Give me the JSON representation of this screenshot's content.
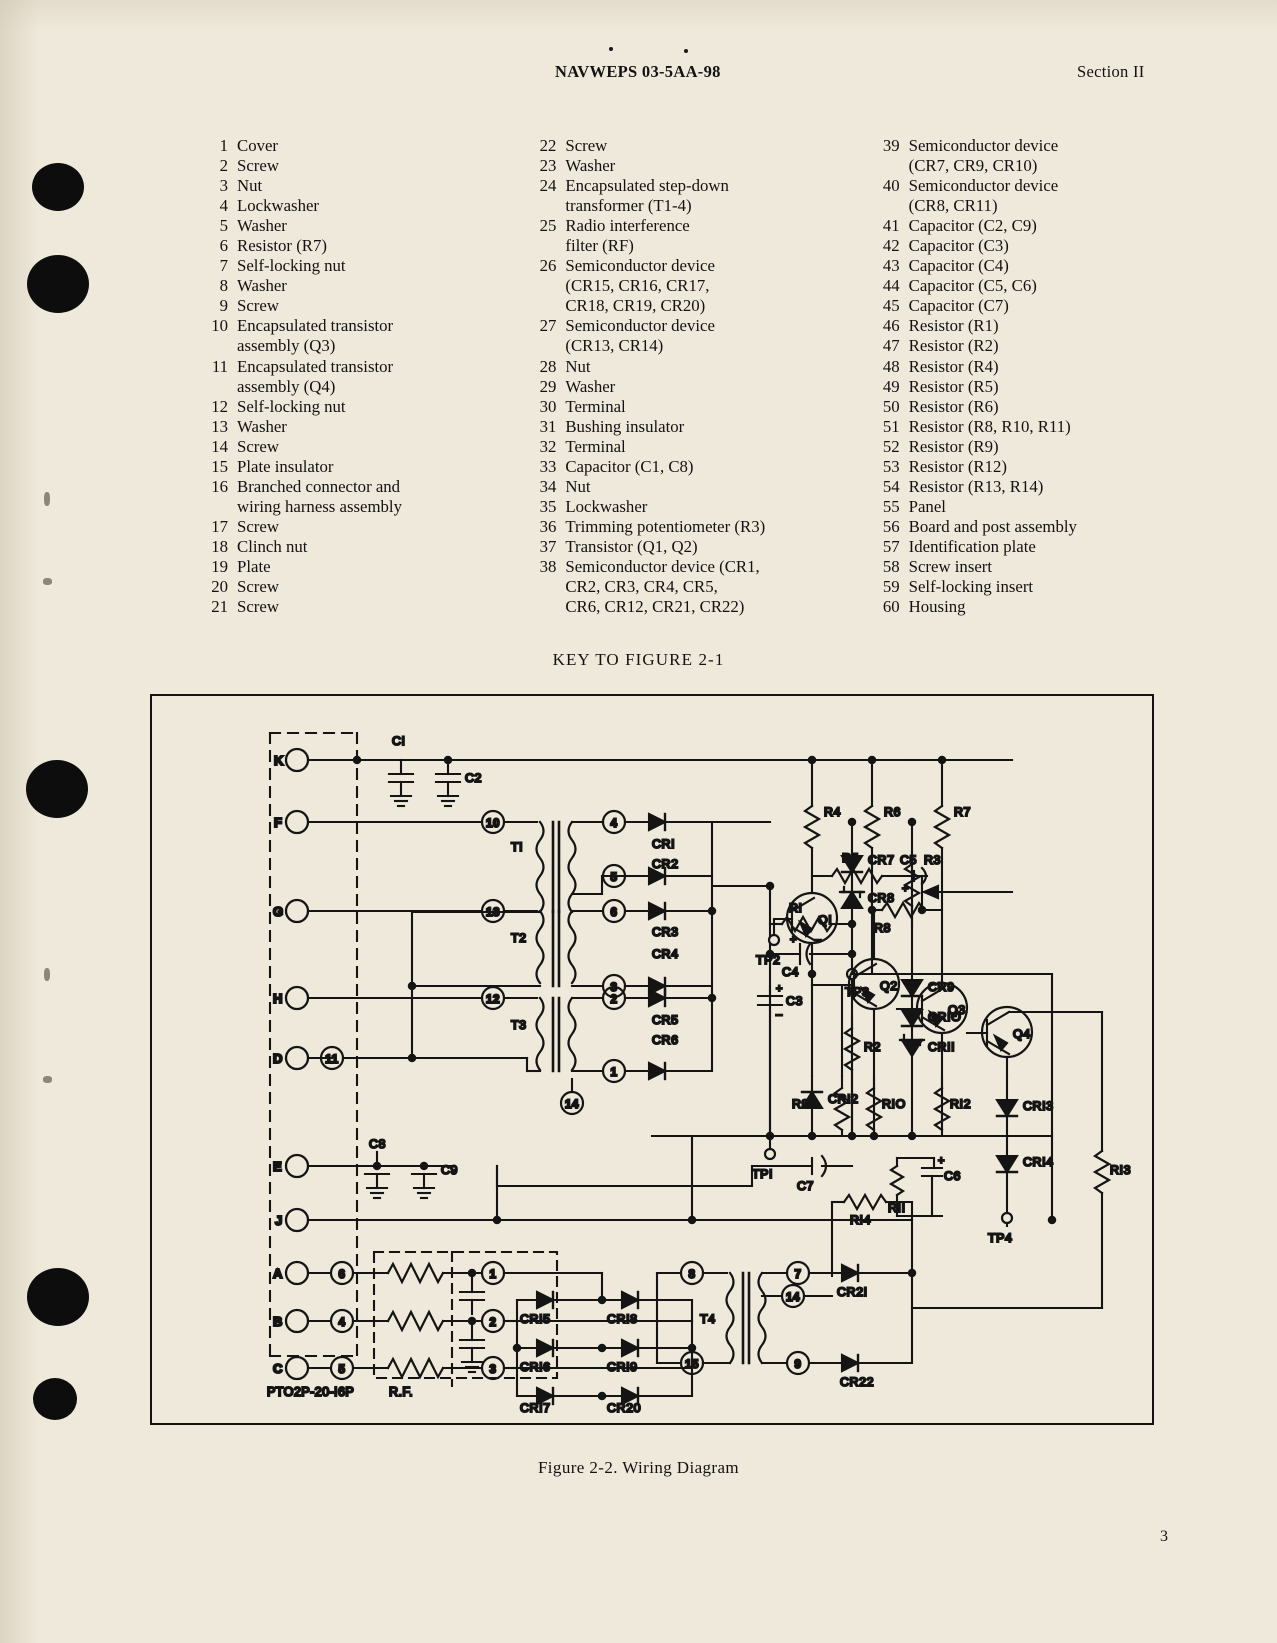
{
  "header": {
    "doc_number": "NAVWEPS 03-5AA-98",
    "section": "Section II"
  },
  "key_caption": "KEY TO FIGURE 2-1",
  "figure_caption": "Figure 2-2.  Wiring Diagram",
  "page_number": "3",
  "parts_key": {
    "column1": [
      {
        "num": "1",
        "text": "Cover"
      },
      {
        "num": "2",
        "text": "Screw"
      },
      {
        "num": "3",
        "text": "Nut"
      },
      {
        "num": "4",
        "text": "Lockwasher"
      },
      {
        "num": "5",
        "text": "Washer"
      },
      {
        "num": "6",
        "text": "Resistor (R7)"
      },
      {
        "num": "7",
        "text": "Self-locking nut"
      },
      {
        "num": "8",
        "text": "Washer"
      },
      {
        "num": "9",
        "text": "Screw"
      },
      {
        "num": "10",
        "text": "Encapsulated transistor",
        "cont": [
          "assembly (Q3)"
        ]
      },
      {
        "num": "11",
        "text": "Encapsulated transistor",
        "cont": [
          "assembly (Q4)"
        ]
      },
      {
        "num": "12",
        "text": "Self-locking nut"
      },
      {
        "num": "13",
        "text": "Washer"
      },
      {
        "num": "14",
        "text": "Screw"
      },
      {
        "num": "15",
        "text": "Plate insulator"
      },
      {
        "num": "16",
        "text": "Branched connector and",
        "cont": [
          "wiring harness assembly"
        ]
      },
      {
        "num": "17",
        "text": "Screw"
      },
      {
        "num": "18",
        "text": "Clinch nut"
      },
      {
        "num": "19",
        "text": "Plate"
      },
      {
        "num": "20",
        "text": "Screw"
      },
      {
        "num": "21",
        "text": "Screw"
      }
    ],
    "column2": [
      {
        "num": "22",
        "text": "Screw"
      },
      {
        "num": "23",
        "text": "Washer"
      },
      {
        "num": "24",
        "text": "Encapsulated step-down",
        "cont": [
          "transformer (T1-4)"
        ]
      },
      {
        "num": "25",
        "text": "Radio interference",
        "cont": [
          "filter (RF)"
        ]
      },
      {
        "num": "26",
        "text": "Semiconductor device",
        "cont": [
          "(CR15, CR16, CR17,",
          "CR18, CR19, CR20)"
        ]
      },
      {
        "num": "27",
        "text": "Semiconductor device",
        "cont": [
          "(CR13, CR14)"
        ]
      },
      {
        "num": "28",
        "text": "Nut"
      },
      {
        "num": "29",
        "text": "Washer"
      },
      {
        "num": "30",
        "text": "Terminal"
      },
      {
        "num": "31",
        "text": "Bushing insulator"
      },
      {
        "num": "32",
        "text": "Terminal"
      },
      {
        "num": "33",
        "text": "Capacitor (C1, C8)"
      },
      {
        "num": "34",
        "text": "Nut"
      },
      {
        "num": "35",
        "text": "Lockwasher"
      },
      {
        "num": "36",
        "text": "Trimming potentiometer (R3)"
      },
      {
        "num": "37",
        "text": "Transistor (Q1, Q2)"
      },
      {
        "num": "38",
        "text": "Semiconductor device (CR1,",
        "cont": [
          "CR2, CR3, CR4, CR5,",
          "CR6, CR12, CR21, CR22)"
        ]
      }
    ],
    "column3": [
      {
        "num": "39",
        "text": "Semiconductor device",
        "cont": [
          "(CR7, CR9, CR10)"
        ]
      },
      {
        "num": "40",
        "text": "Semiconductor device",
        "cont": [
          "(CR8, CR11)"
        ]
      },
      {
        "num": "41",
        "text": "Capacitor (C2, C9)"
      },
      {
        "num": "42",
        "text": "Capacitor (C3)"
      },
      {
        "num": "43",
        "text": "Capacitor (C4)"
      },
      {
        "num": "44",
        "text": "Capacitor (C5, C6)"
      },
      {
        "num": "45",
        "text": "Capacitor (C7)"
      },
      {
        "num": "46",
        "text": "Resistor (R1)"
      },
      {
        "num": "47",
        "text": "Resistor (R2)"
      },
      {
        "num": "48",
        "text": "Resistor (R4)"
      },
      {
        "num": "49",
        "text": "Resistor (R5)"
      },
      {
        "num": "50",
        "text": "Resistor (R6)"
      },
      {
        "num": "51",
        "text": "Resistor (R8, R10, R11)"
      },
      {
        "num": "52",
        "text": "Resistor (R9)"
      },
      {
        "num": "53",
        "text": "Resistor (R12)"
      },
      {
        "num": "54",
        "text": "Resistor (R13, R14)"
      },
      {
        "num": "55",
        "text": "Panel"
      },
      {
        "num": "56",
        "text": "Board and post assembly"
      },
      {
        "num": "57",
        "text": "Identification plate"
      },
      {
        "num": "58",
        "text": "Screw insert"
      },
      {
        "num": "59",
        "text": "Self-locking insert"
      },
      {
        "num": "60",
        "text": "Housing"
      }
    ]
  },
  "schematic": {
    "connector_label": "PTO2P-20-I6P",
    "rf_label": "R.F.",
    "terminals": [
      "K",
      "F",
      "G",
      "H",
      "D",
      "E",
      "J",
      "A",
      "B",
      "C"
    ],
    "transformers": [
      "T1",
      "T2",
      "T3",
      "T4"
    ],
    "transistors": [
      "Q1",
      "Q2",
      "Q3",
      "Q4"
    ],
    "test_points": [
      "TP1",
      "TP2",
      "TP3",
      "TP4"
    ],
    "capacitors": [
      "C1",
      "C2",
      "C3",
      "C4",
      "C5",
      "C6",
      "C7",
      "C8",
      "C9"
    ],
    "resistors": [
      "R1",
      "R2",
      "R3",
      "R4",
      "R5",
      "R6",
      "R7",
      "R8",
      "R9",
      "R10",
      "R11",
      "R12",
      "R13",
      "R14"
    ],
    "diodes": [
      "CR1",
      "CR2",
      "CR3",
      "CR4",
      "CR5",
      "CR6",
      "CR7",
      "CR8",
      "CR9",
      "CR10",
      "CR11",
      "CR12",
      "CR13",
      "CR14",
      "CR15",
      "CR16",
      "CR17",
      "CR18",
      "CR19",
      "CR20",
      "CR21",
      "CR22"
    ],
    "pin_numbers": [
      "1",
      "2",
      "3",
      "4",
      "5",
      "6",
      "7",
      "8",
      "9",
      "10",
      "11",
      "12",
      "13",
      "14",
      "15"
    ],
    "labels": {
      "c1": "CI",
      "c2": "C2",
      "c3": "C3",
      "c4": "C4",
      "c5": "C5",
      "c6": "C6",
      "c7": "C7",
      "c8": "C8",
      "c9": "C9",
      "r1": "RI",
      "r2": "R2",
      "r3": "R3",
      "r4": "R4",
      "r5": "R5",
      "r6": "R6",
      "r7": "R7",
      "r8": "R8",
      "r9": "R9",
      "r10": "RIO",
      "r11": "RII",
      "r12": "RI2",
      "r13": "RI3",
      "r14": "RI4",
      "t1": "TI",
      "t2": "T2",
      "t3": "T3",
      "t4": "T4",
      "q1": "QI",
      "q2": "Q2",
      "q3": "Q3",
      "q4": "Q4",
      "tp1": "TPI",
      "tp2": "TP2",
      "tp3": "TP3",
      "tp4": "TP4",
      "cr1": "CRI",
      "cr2": "CR2",
      "cr3": "CR3",
      "cr4": "CR4",
      "cr5": "CR5",
      "cr6": "CR6",
      "cr7": "CR7",
      "cr8": "CR8",
      "cr9": "CR9",
      "cr10": "CRIO",
      "cr11": "CRII",
      "cr12": "CRI2",
      "cr13": "CRI3",
      "cr14": "CRI4",
      "cr15": "CRI5",
      "cr16": "CRI6",
      "cr17": "CRI7",
      "cr18": "CRI8",
      "cr19": "CRI9",
      "cr20": "CR20",
      "cr21": "CR2I",
      "cr22": "CR22"
    }
  }
}
